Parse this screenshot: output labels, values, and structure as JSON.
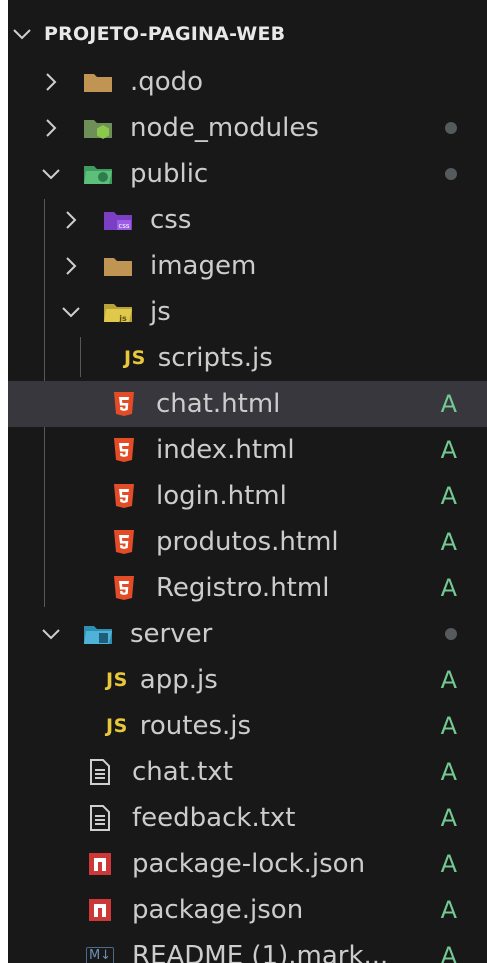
{
  "header": {
    "title": "PROJETO-PAGINA-WEB"
  },
  "tree": {
    "qodo": {
      "label": ".qodo"
    },
    "node_modules": {
      "label": "node_modules"
    },
    "public": {
      "label": "public"
    },
    "css": {
      "label": "css"
    },
    "imagem": {
      "label": "imagem"
    },
    "js": {
      "label": "js"
    },
    "scripts_js": {
      "label": "scripts.js"
    },
    "chat_html": {
      "label": "chat.html",
      "status": "A"
    },
    "index_html": {
      "label": "index.html",
      "status": "A"
    },
    "login_html": {
      "label": "login.html",
      "status": "A"
    },
    "produtos_html": {
      "label": "produtos.html",
      "status": "A"
    },
    "registro_html": {
      "label": "Registro.html",
      "status": "A"
    },
    "server": {
      "label": "server"
    },
    "app_js": {
      "label": "app.js",
      "status": "A"
    },
    "routes_js": {
      "label": "routes.js",
      "status": "A"
    },
    "chat_txt": {
      "label": "chat.txt",
      "status": "A"
    },
    "feedback_txt": {
      "label": "feedback.txt",
      "status": "A"
    },
    "package_lock": {
      "label": "package-lock.json",
      "status": "A"
    },
    "package_json": {
      "label": "package.json",
      "status": "A"
    },
    "readme": {
      "label": "README (1).mark...",
      "status": "A"
    }
  },
  "badges": {
    "js": "JS",
    "md": "M↓",
    "css": "css",
    "node": "js"
  },
  "colors": {
    "background": "#181818",
    "selected_row": "#37373d",
    "status_added": "#73c991",
    "text": "#cccccc"
  },
  "icons": {
    "collapsed": "chevron-right-icon",
    "expanded": "chevron-down-icon",
    "folder": "folder-icon",
    "html": "html5-icon",
    "js": "javascript-icon",
    "txt": "text-file-icon",
    "npm": "npm-icon",
    "markdown": "markdown-icon"
  }
}
